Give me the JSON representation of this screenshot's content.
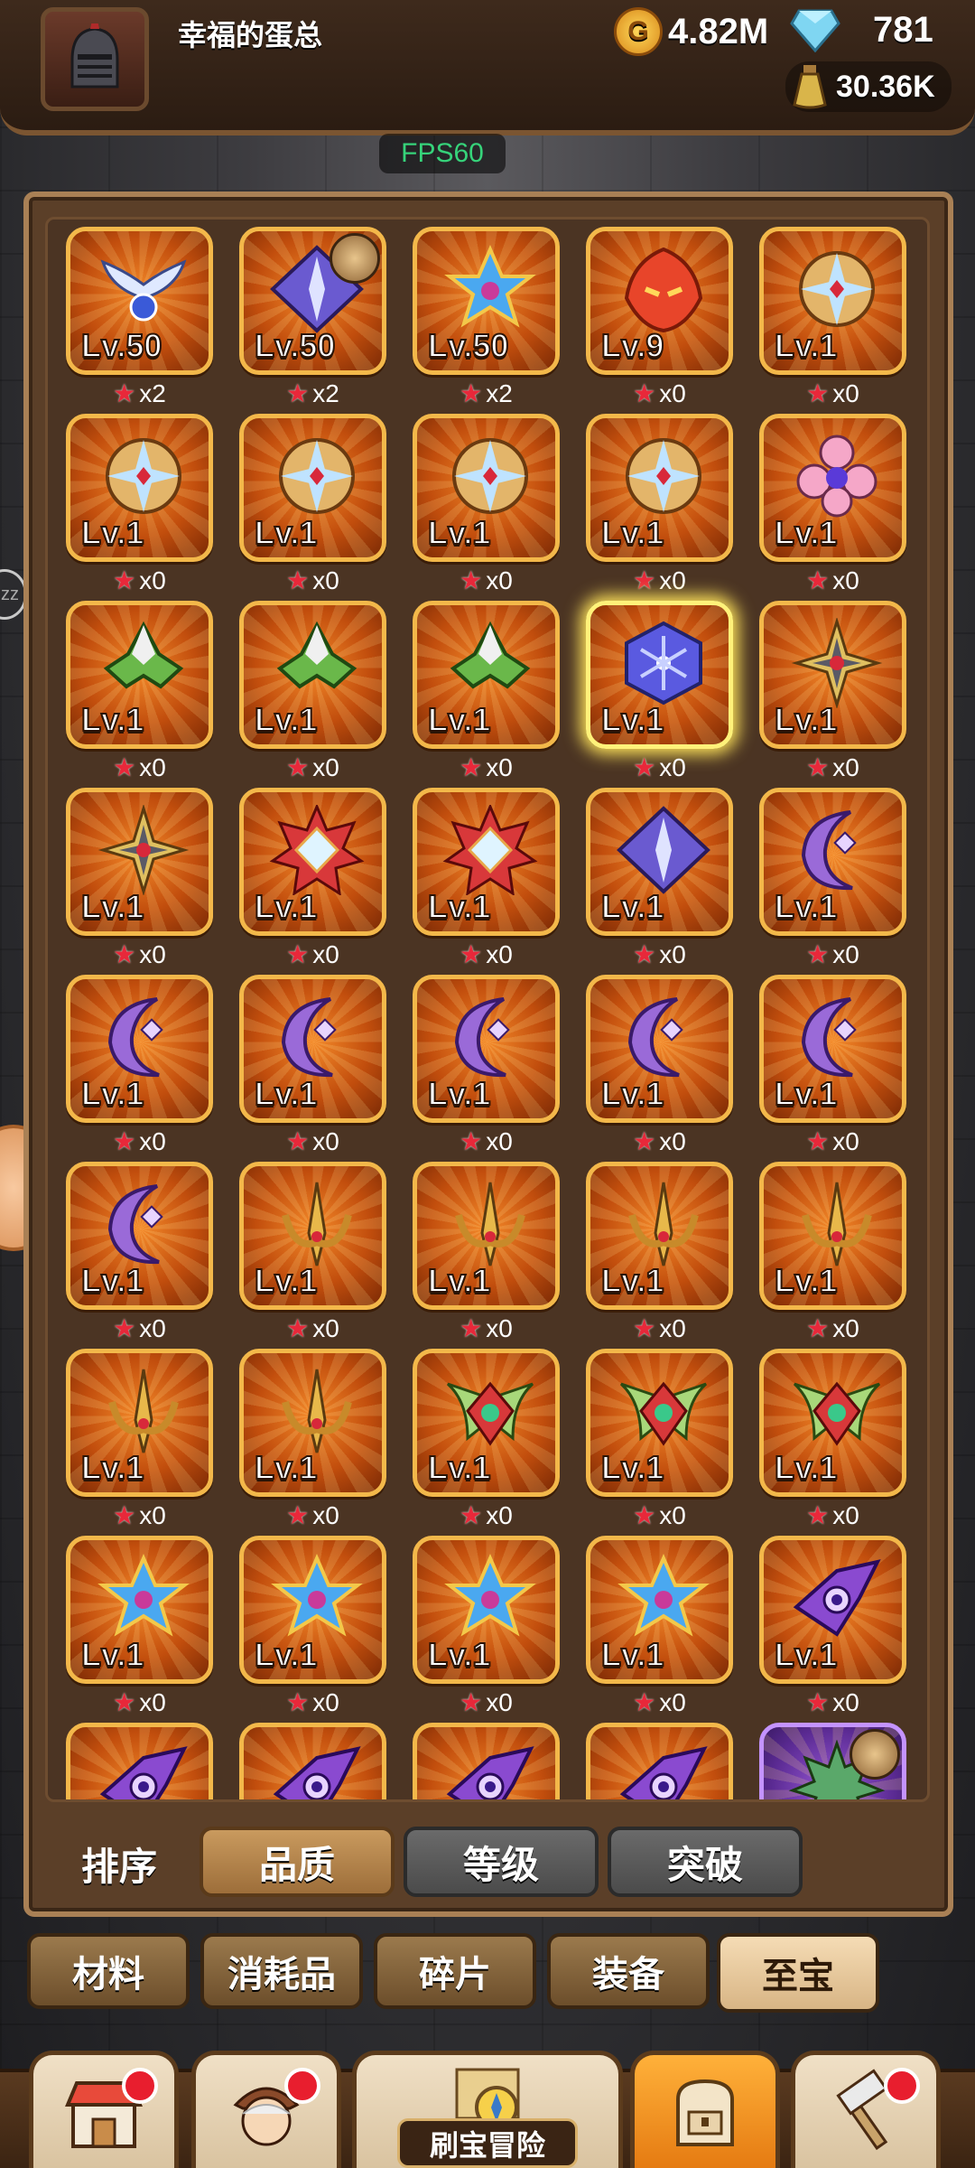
{
  "player": {
    "name": "幸福的蛋总"
  },
  "resources": {
    "gold": "4.82M",
    "gems": "781",
    "potion": "30.36K"
  },
  "fps": "FPS60",
  "side": {
    "zz": "zz"
  },
  "items": [
    {
      "lv": "Lv.50",
      "stars": "x2",
      "art": "wings-icon"
    },
    {
      "lv": "Lv.50",
      "stars": "x2",
      "art": "spear-diamond-icon",
      "badge": true
    },
    {
      "lv": "Lv.50",
      "stars": "x2",
      "art": "blue-star-emblem-icon"
    },
    {
      "lv": "Lv.9",
      "stars": "x0",
      "art": "fire-mask-icon"
    },
    {
      "lv": "Lv.1",
      "stars": "x0",
      "art": "gold-shield-icon"
    },
    {
      "lv": "Lv.1",
      "stars": "x0",
      "art": "gold-shield-icon"
    },
    {
      "lv": "Lv.1",
      "stars": "x0",
      "art": "gold-shield-icon"
    },
    {
      "lv": "Lv.1",
      "stars": "x0",
      "art": "gold-shield-icon"
    },
    {
      "lv": "Lv.1",
      "stars": "x0",
      "art": "gold-shield-icon"
    },
    {
      "lv": "Lv.1",
      "stars": "x0",
      "art": "pink-flower-icon"
    },
    {
      "lv": "Lv.1",
      "stars": "x0",
      "art": "green-helm-icon"
    },
    {
      "lv": "Lv.1",
      "stars": "x0",
      "art": "green-helm-icon"
    },
    {
      "lv": "Lv.1",
      "stars": "x0",
      "art": "green-helm-icon"
    },
    {
      "lv": "Lv.1",
      "stars": "x0",
      "art": "blue-snowflake-icon",
      "selected": true
    },
    {
      "lv": "Lv.1",
      "stars": "x0",
      "art": "shuriken-icon"
    },
    {
      "lv": "Lv.1",
      "stars": "x0",
      "art": "shuriken-icon"
    },
    {
      "lv": "Lv.1",
      "stars": "x0",
      "art": "red-star-gem-icon"
    },
    {
      "lv": "Lv.1",
      "stars": "x0",
      "art": "red-star-gem-icon"
    },
    {
      "lv": "Lv.1",
      "stars": "x0",
      "art": "spear-diamond-icon"
    },
    {
      "lv": "Lv.1",
      "stars": "x0",
      "art": "purple-moon-icon"
    },
    {
      "lv": "Lv.1",
      "stars": "x0",
      "art": "purple-moon-icon"
    },
    {
      "lv": "Lv.1",
      "stars": "x0",
      "art": "purple-moon-icon"
    },
    {
      "lv": "Lv.1",
      "stars": "x0",
      "art": "purple-moon-icon"
    },
    {
      "lv": "Lv.1",
      "stars": "x0",
      "art": "purple-moon-icon"
    },
    {
      "lv": "Lv.1",
      "stars": "x0",
      "art": "purple-moon-icon"
    },
    {
      "lv": "Lv.1",
      "stars": "x0",
      "art": "purple-moon-icon"
    },
    {
      "lv": "Lv.1",
      "stars": "x0",
      "art": "gold-trident-icon"
    },
    {
      "lv": "Lv.1",
      "stars": "x0",
      "art": "gold-trident-icon"
    },
    {
      "lv": "Lv.1",
      "stars": "x0",
      "art": "gold-trident-icon"
    },
    {
      "lv": "Lv.1",
      "stars": "x0",
      "art": "gold-trident-icon"
    },
    {
      "lv": "Lv.1",
      "stars": "x0",
      "art": "gold-trident-icon"
    },
    {
      "lv": "Lv.1",
      "stars": "x0",
      "art": "gold-trident-icon"
    },
    {
      "lv": "Lv.1",
      "stars": "x0",
      "art": "green-wing-gem-icon"
    },
    {
      "lv": "Lv.1",
      "stars": "x0",
      "art": "green-wing-gem-icon"
    },
    {
      "lv": "Lv.1",
      "stars": "x0",
      "art": "green-wing-gem-icon"
    },
    {
      "lv": "Lv.1",
      "stars": "x0",
      "art": "blue-star-emblem-icon"
    },
    {
      "lv": "Lv.1",
      "stars": "x0",
      "art": "blue-star-emblem-icon"
    },
    {
      "lv": "Lv.1",
      "stars": "x0",
      "art": "blue-star-emblem-icon"
    },
    {
      "lv": "Lv.1",
      "stars": "x0",
      "art": "blue-star-emblem-icon"
    },
    {
      "lv": "Lv.1",
      "stars": "x0",
      "art": "purple-eye-icon"
    },
    {
      "lv": "",
      "stars": "",
      "art": "purple-eye-icon"
    },
    {
      "lv": "",
      "stars": "",
      "art": "purple-eye-icon"
    },
    {
      "lv": "",
      "stars": "",
      "art": "purple-eye-icon"
    },
    {
      "lv": "",
      "stars": "",
      "art": "purple-eye-icon"
    },
    {
      "lv": "",
      "stars": "",
      "art": "green-spike-icon",
      "purple": true,
      "badge": true
    }
  ],
  "sort": {
    "label": "排序",
    "options": [
      "品质",
      "等级",
      "突破"
    ],
    "active": 0
  },
  "categories": [
    "材料",
    "消耗品",
    "碎片",
    "装备",
    "至宝"
  ],
  "active_category": 4,
  "nav": {
    "items": [
      {
        "icon": "shop-icon",
        "dot": true
      },
      {
        "icon": "hero-portrait-icon",
        "dot": true
      },
      {
        "icon": "treasure-map-icon",
        "label": "刷宝冒险"
      },
      {
        "icon": "backpack-icon",
        "active": true
      },
      {
        "icon": "forge-hammer-icon",
        "dot": true
      }
    ]
  },
  "colors": {
    "card_border": "#f3b84a",
    "card_fill": "#c24e0d",
    "star": "#e8283a",
    "fps": "#36d37a",
    "selected_glow": "#ffe45a"
  }
}
